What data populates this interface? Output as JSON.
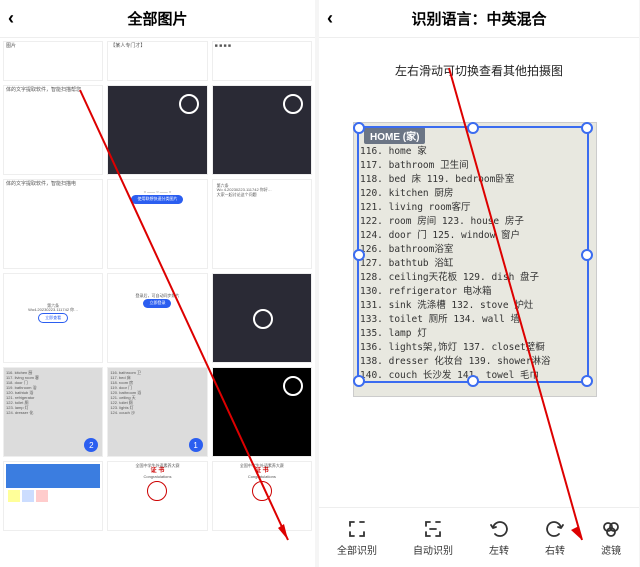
{
  "left": {
    "title": "全部图片",
    "thumbs": [
      {
        "desc": "体的文字提取软件，智能扫描帮您"
      },
      {
        "desc": ""
      },
      {
        "desc": ""
      }
    ]
  },
  "right": {
    "title": "识别语言：中英混合",
    "hint": "左右滑动可切换查看其他拍摄图",
    "doc_title": "HOME (家)",
    "lines": [
      "116. home 家",
      "117. bathroom 卫生间",
      "118. bed 床        119. bedroom卧室",
      "120. kitchen 厨房",
      "121. living room客厅",
      "122. room 房间       123. house 房子",
      "124. door 门        125. window 窗户",
      "126. bathroom浴室",
      "127. bathtub 浴缸",
      "128. ceiling天花板  129. dish 盘子",
      "130. refrigerator 电冰箱",
      "131. sink 洗涤槽    132. stove 炉灶",
      "133. toilet 厕所    134. wall 墙",
      "135. lamp 灯",
      "136. lights架,饰灯  137. closet壁橱",
      "138. dresser 化妆台 139. shower淋浴",
      "140. couch 长沙发   141. towel 毛巾"
    ],
    "tools": [
      {
        "key": "full",
        "label": "全部识别"
      },
      {
        "key": "auto",
        "label": "自动识别"
      },
      {
        "key": "rotl",
        "label": "左转"
      },
      {
        "key": "rotr",
        "label": "右转"
      },
      {
        "key": "filter",
        "label": "滤镜"
      }
    ]
  }
}
